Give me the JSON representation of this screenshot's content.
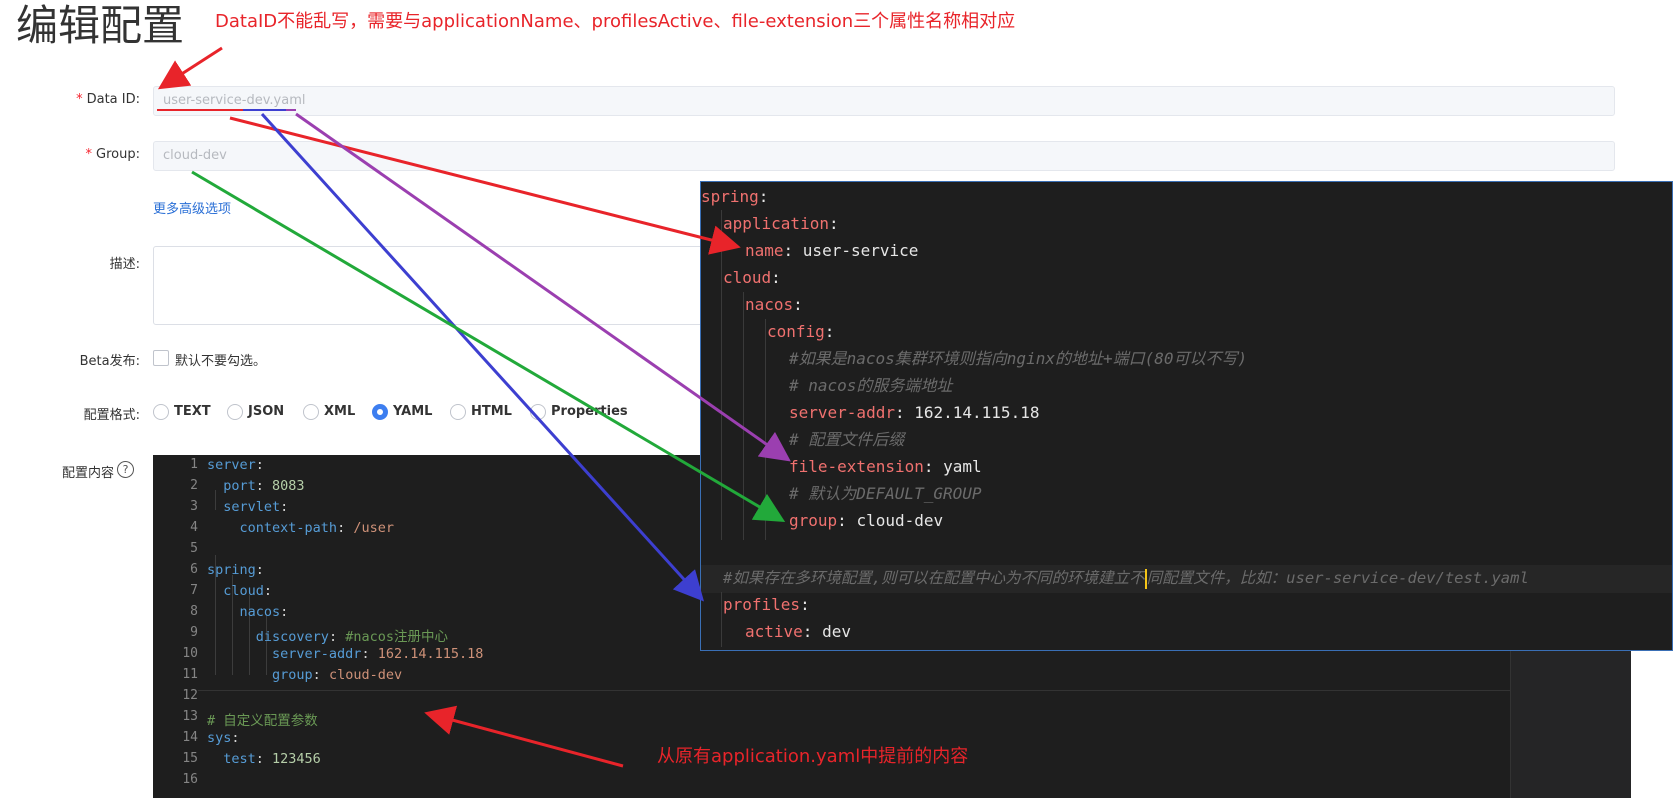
{
  "page": {
    "title": "编辑配置"
  },
  "annotations": {
    "top": "DataID不能乱写，需要与applicationName、profilesActive、file-extension三个属性名称相对应",
    "bottom": "从原有application.yaml中提前的内容"
  },
  "form": {
    "required_mark": "*",
    "data_id": {
      "label": "Data ID:",
      "value": "user-service-dev.yaml"
    },
    "group": {
      "label": "Group:",
      "value": "cloud-dev"
    },
    "advanced_link": "更多高级选项",
    "description": {
      "label": "描述:",
      "value": ""
    },
    "beta": {
      "label": "Beta发布:",
      "checkbox_text": "默认不要勾选。",
      "checked": false
    },
    "format": {
      "label": "配置格式:",
      "options": [
        "TEXT",
        "JSON",
        "XML",
        "YAML",
        "HTML",
        "Properties"
      ],
      "selected": "YAML"
    },
    "content": {
      "label": "配置内容",
      "help_icon": "?"
    }
  },
  "editor": {
    "line_numbers": [
      "1",
      "2",
      "3",
      "4",
      "5",
      "6",
      "7",
      "8",
      "9",
      "10",
      "11",
      "12",
      "13",
      "14",
      "15",
      "16"
    ],
    "lines": {
      "l1_key": "server",
      "l2_key": "port",
      "l2_val": "8083",
      "l3_key": "servlet",
      "l4_key": "context-path",
      "l4_val": "/user",
      "l6_key": "spring",
      "l7_key": "cloud",
      "l8_key": "nacos",
      "l9_key": "discovery",
      "l9_comment": "#nacos注册中心",
      "l10_key": "server-addr",
      "l10_val": "162.14.115.18",
      "l11_key": "group",
      "l11_val": "cloud-dev",
      "l13_comment": "# 自定义配置参数",
      "l14_key": "sys",
      "l15_key": "test",
      "l15_val": "123456"
    }
  },
  "overlay": {
    "spring": "spring",
    "application": "application",
    "name_key": "name",
    "name_val": "user-service",
    "cloud": "cloud",
    "nacos": "nacos",
    "config": "config",
    "comment1": "#如果是nacos集群环境则指向nginx的地址+端口(80可以不写)",
    "comment2": "# nacos的服务端地址",
    "server_addr_key": "server-addr",
    "server_addr_val": "162.14.115.18",
    "comment3": "# 配置文件后缀",
    "file_ext_key": "file-extension",
    "file_ext_val": "yaml",
    "comment4": "# 默认为DEFAULT_GROUP",
    "group_key": "group",
    "group_val": "cloud-dev",
    "comment5a": "#如果存在多环境配置,则可以在配置中心为不同的环境建立不",
    "comment5b": "同配置文件，比如：user-service-dev/test.yaml",
    "profiles": "profiles",
    "active_key": "active",
    "active_val": "dev"
  },
  "colors": {
    "annotation": "#e8242a",
    "link": "#2a6fd6",
    "radio_on": "#3d7ef0",
    "editor_bg": "#1e1e1e",
    "overlay_key": "#f0716f"
  }
}
